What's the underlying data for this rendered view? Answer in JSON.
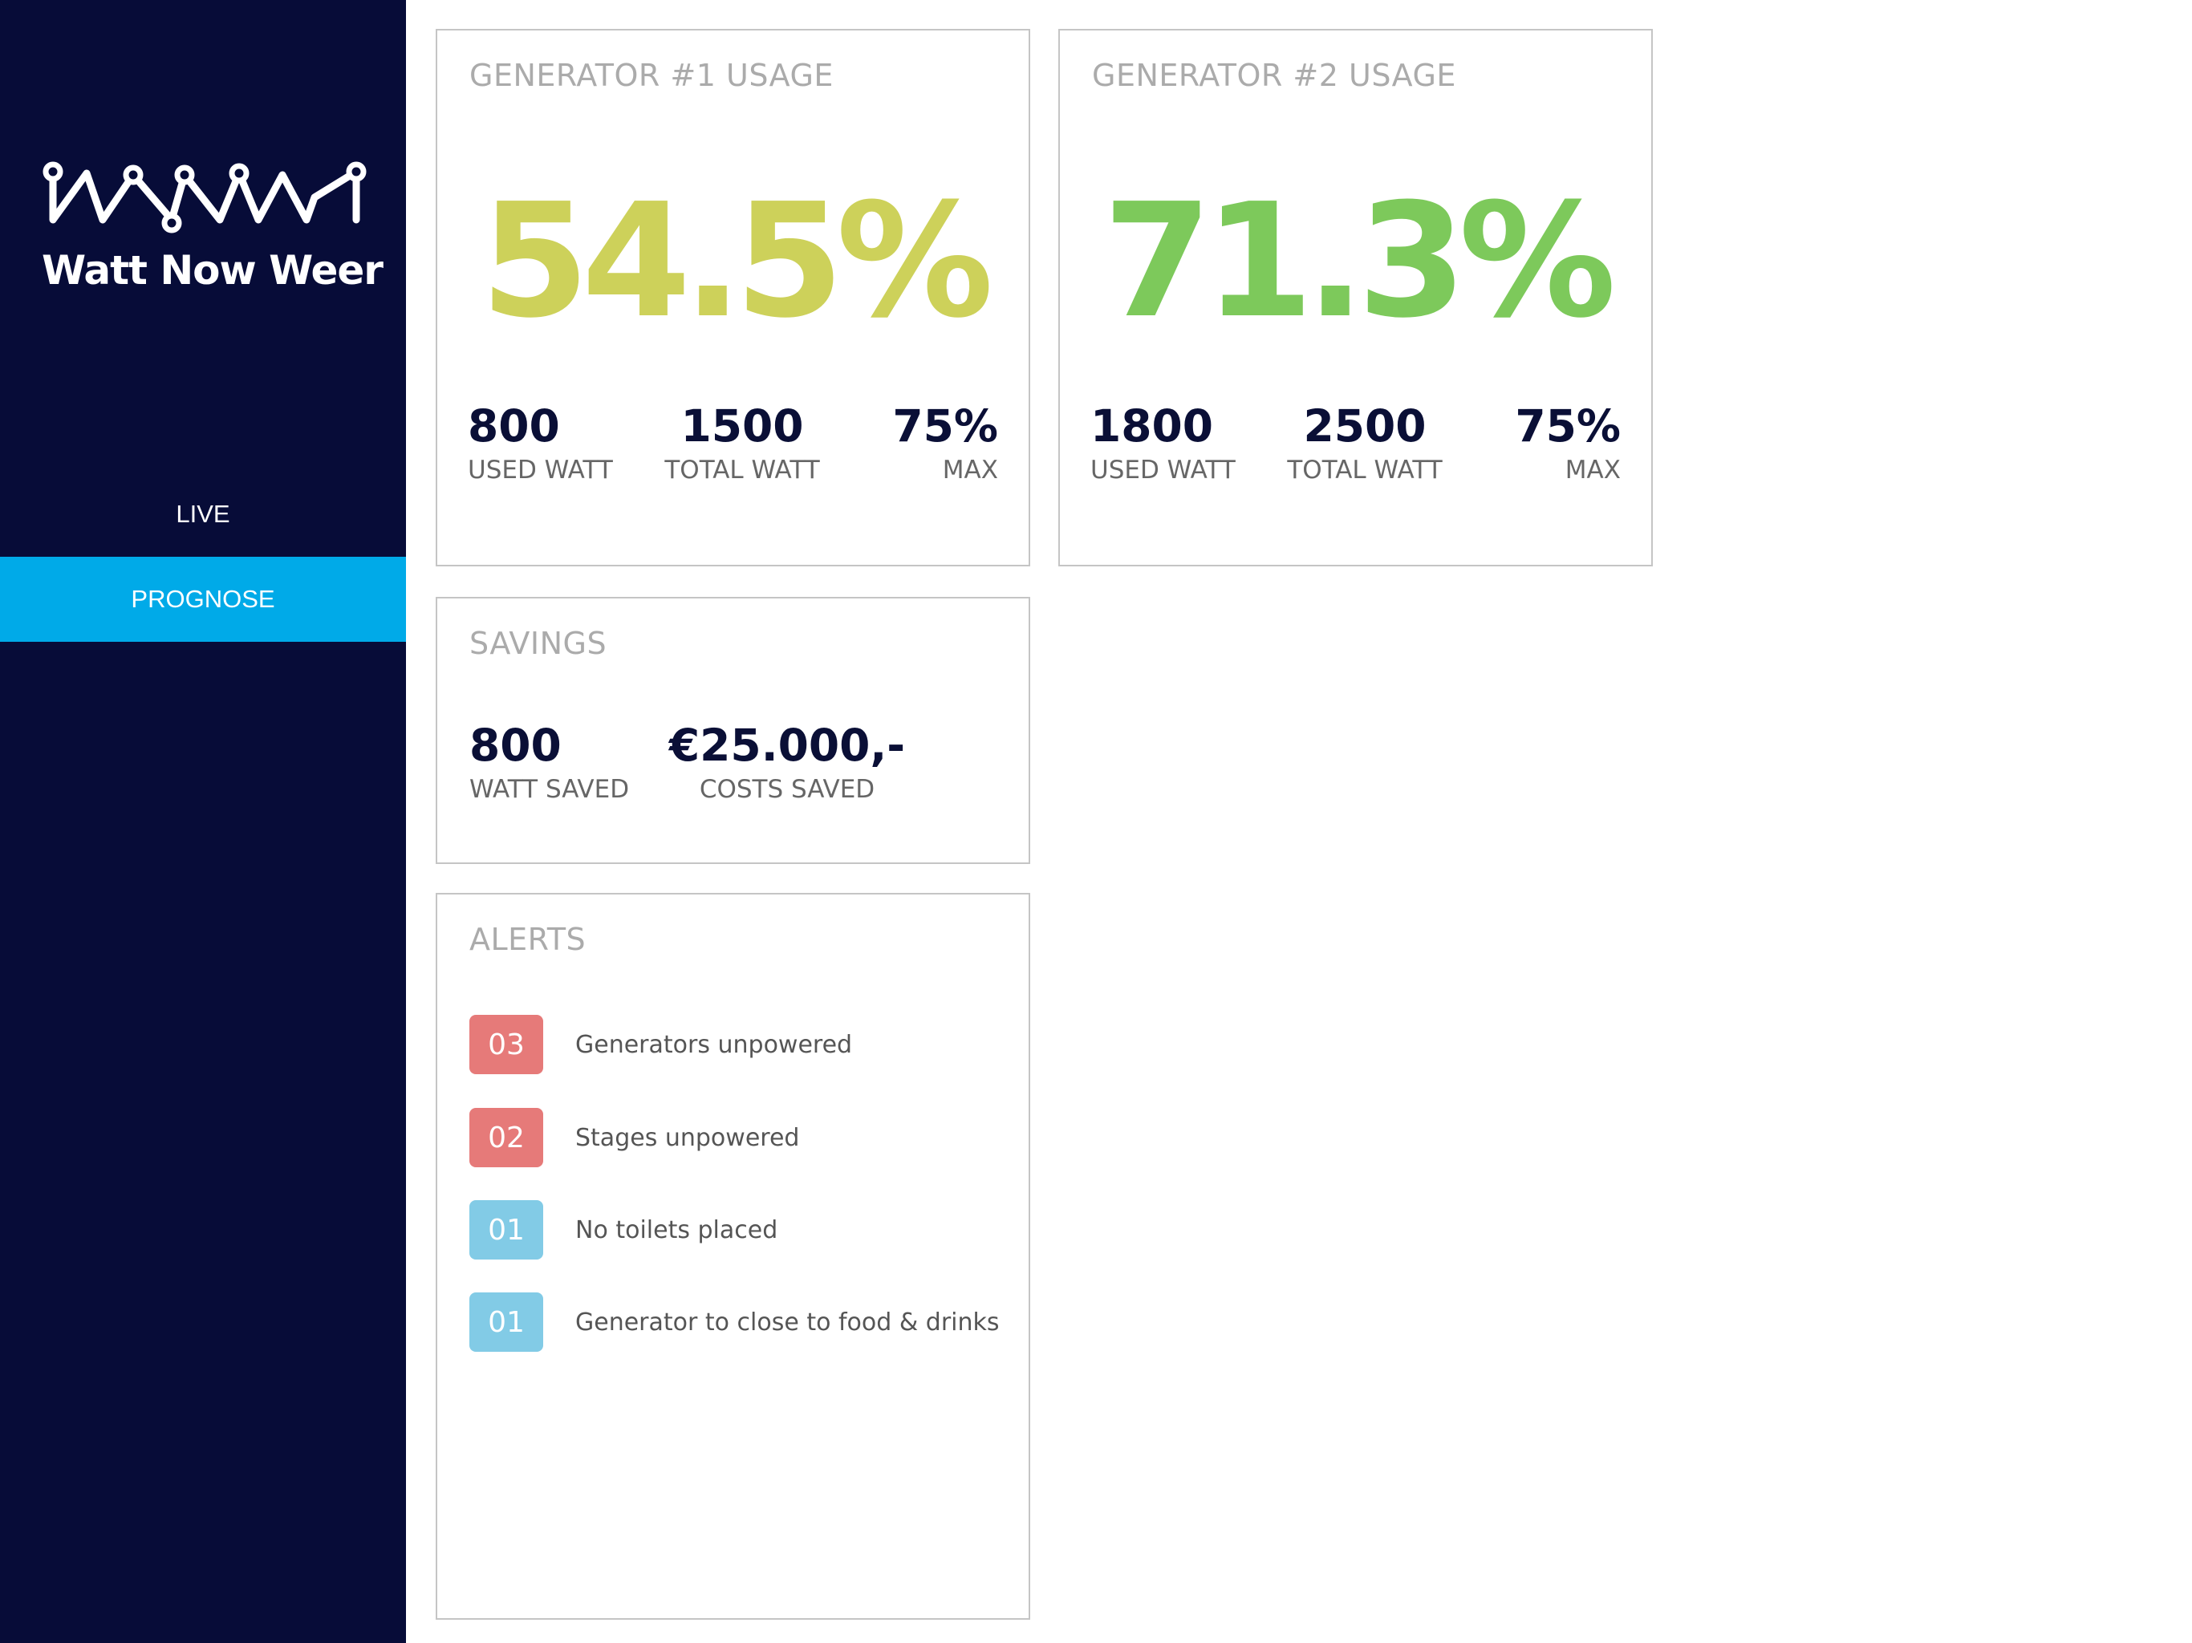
{
  "brand": {
    "name": "Watt Now Weer"
  },
  "nav": {
    "items": [
      {
        "label": "LIVE"
      },
      {
        "label": "PROGNOSE"
      }
    ]
  },
  "generators": [
    {
      "title": "GENERATOR #1 USAGE",
      "usage": "54.5%",
      "usage_color": "#cdd15a",
      "stats": [
        {
          "value": "800",
          "label": "USED WATT"
        },
        {
          "value": "1500",
          "label": "TOTAL WATT"
        },
        {
          "value": "75%",
          "label": "MAX"
        }
      ]
    },
    {
      "title": "GENERATOR #2 USAGE",
      "usage": "71.3%",
      "usage_color": "#7dc95b",
      "stats": [
        {
          "value": "1800",
          "label": "USED WATT"
        },
        {
          "value": "2500",
          "label": "TOTAL WATT"
        },
        {
          "value": "75%",
          "label": "MAX"
        }
      ]
    }
  ],
  "savings": {
    "title": "SAVINGS",
    "stats": [
      {
        "value": "800",
        "label": "WATT SAVED"
      },
      {
        "value": "€25.000,-",
        "label": "COSTS SAVED"
      }
    ]
  },
  "alerts": {
    "title": "ALERTS",
    "items": [
      {
        "count": "03",
        "text": "Generators unpowered",
        "severity": "red"
      },
      {
        "count": "02",
        "text": "Stages unpowered",
        "severity": "red"
      },
      {
        "count": "01",
        "text": "No toilets placed",
        "severity": "blue"
      },
      {
        "count": "01",
        "text": "Generator to close to food & drinks",
        "severity": "blue"
      }
    ]
  },
  "colors": {
    "sidebar": "#070c38",
    "accent": "#00aae8",
    "alert_red": "#e67a79",
    "alert_blue": "#82cbe6"
  }
}
